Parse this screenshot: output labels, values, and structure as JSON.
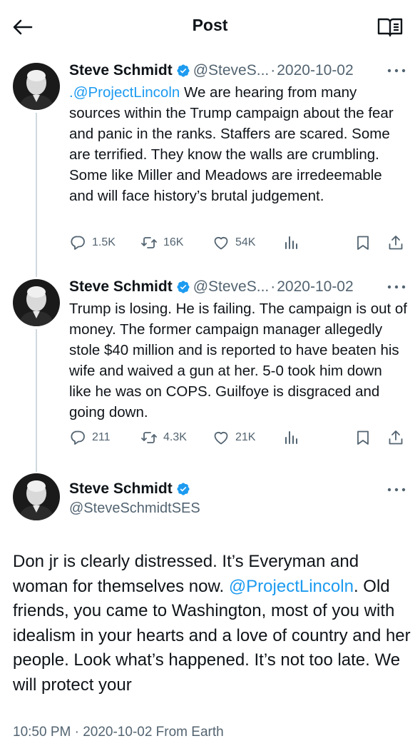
{
  "header": {
    "title": "Post"
  },
  "tweets": [
    {
      "name": "Steve Schmidt",
      "handle": "@SteveS...",
      "dot": "·",
      "date": "2020-10-02",
      "mention": ".@ProjectLincoln",
      "text": " We are hearing from many sources within the Trump campaign about the fear and panic in the ranks. Staffers are scared. Some are terrified. They know the walls are crumbling. Some like Miller and Meadows are irredeemable and will face history’s brutal judgement.",
      "replies": "1.5K",
      "reposts": "16K",
      "likes": "54K"
    },
    {
      "name": "Steve Schmidt",
      "handle": "@SteveS...",
      "dot": "·",
      "date": "2020-10-02",
      "text": "Trump is losing. He is failing. The campaign is out of money.  The former campaign manager allegedly stole $40 million and is reported to have beaten his wife and waived a gun at her. 5-0 took him down like he was on COPS. Guilfoye is disgraced and going down.",
      "replies": "211",
      "reposts": "4.3K",
      "likes": "21K"
    }
  ],
  "main": {
    "name": "Steve Schmidt",
    "handle": "@SteveSchmidtSES",
    "text_before": "Don jr is clearly distressed.  It’s Everyman and woman for themselves now. ",
    "mention": "@ProjectLincoln",
    "text_after": ". Old friends, you came to Washington, most of you with idealism in your hearts and a love of country and her people. Look what’s happened. It’s not too late. We will protect your",
    "meta": "10:50 PM · 2020-10-02 From Earth"
  },
  "colors": {
    "accent": "#1d9bf0",
    "secondary": "#536471",
    "thread": "#cfd9de"
  },
  "icons": [
    "back-arrow-icon",
    "reader-mode-icon",
    "verified-badge-icon",
    "more-icon",
    "reply-icon",
    "repost-icon",
    "like-icon",
    "views-icon",
    "bookmark-icon",
    "share-icon"
  ]
}
